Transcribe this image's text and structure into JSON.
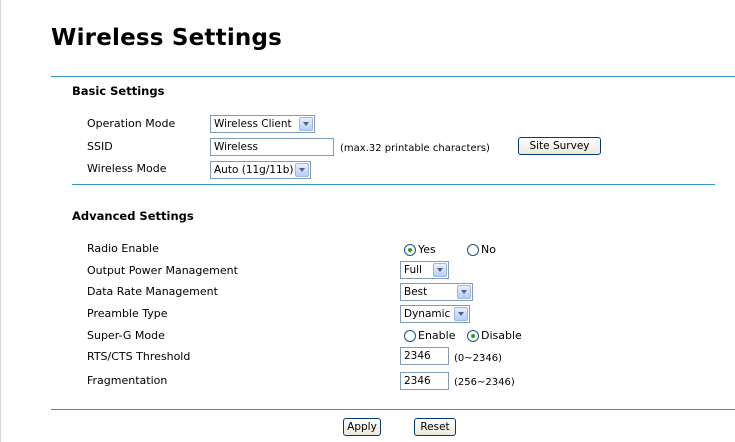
{
  "page": {
    "title": "Wireless Settings"
  },
  "basic": {
    "title": "Basic Settings",
    "operation_mode": {
      "label": "Operation Mode",
      "value": "Wireless Client"
    },
    "ssid": {
      "label": "SSID",
      "value": "Wireless",
      "hint": "(max.32 printable characters)"
    },
    "site_survey": "Site Survey",
    "wireless_mode": {
      "label": "Wireless Mode",
      "value": "Auto (11g/11b)"
    }
  },
  "advanced": {
    "title": "Advanced Settings",
    "radio_enable": {
      "label": "Radio Enable",
      "yes": "Yes",
      "no": "No",
      "selected": "Yes"
    },
    "output_power": {
      "label": "Output Power Management",
      "value": "Full"
    },
    "data_rate": {
      "label": "Data Rate Management",
      "value": "Best"
    },
    "preamble": {
      "label": "Preamble Type",
      "value": "Dynamic"
    },
    "super_g": {
      "label": "Super-G Mode",
      "enable": "Enable",
      "disable": "Disable",
      "selected": "Disable"
    },
    "rts": {
      "label": "RTS/CTS Threshold",
      "value": "2346",
      "hint": "(0~2346)"
    },
    "frag": {
      "label": "Fragmentation",
      "value": "2346",
      "hint": "(256~2346)"
    }
  },
  "actions": {
    "apply": "Apply",
    "reset": "Reset"
  },
  "colors": {
    "rule": "#3a96c7",
    "radio_dot": "#21a121",
    "button_border": "#003c74"
  }
}
